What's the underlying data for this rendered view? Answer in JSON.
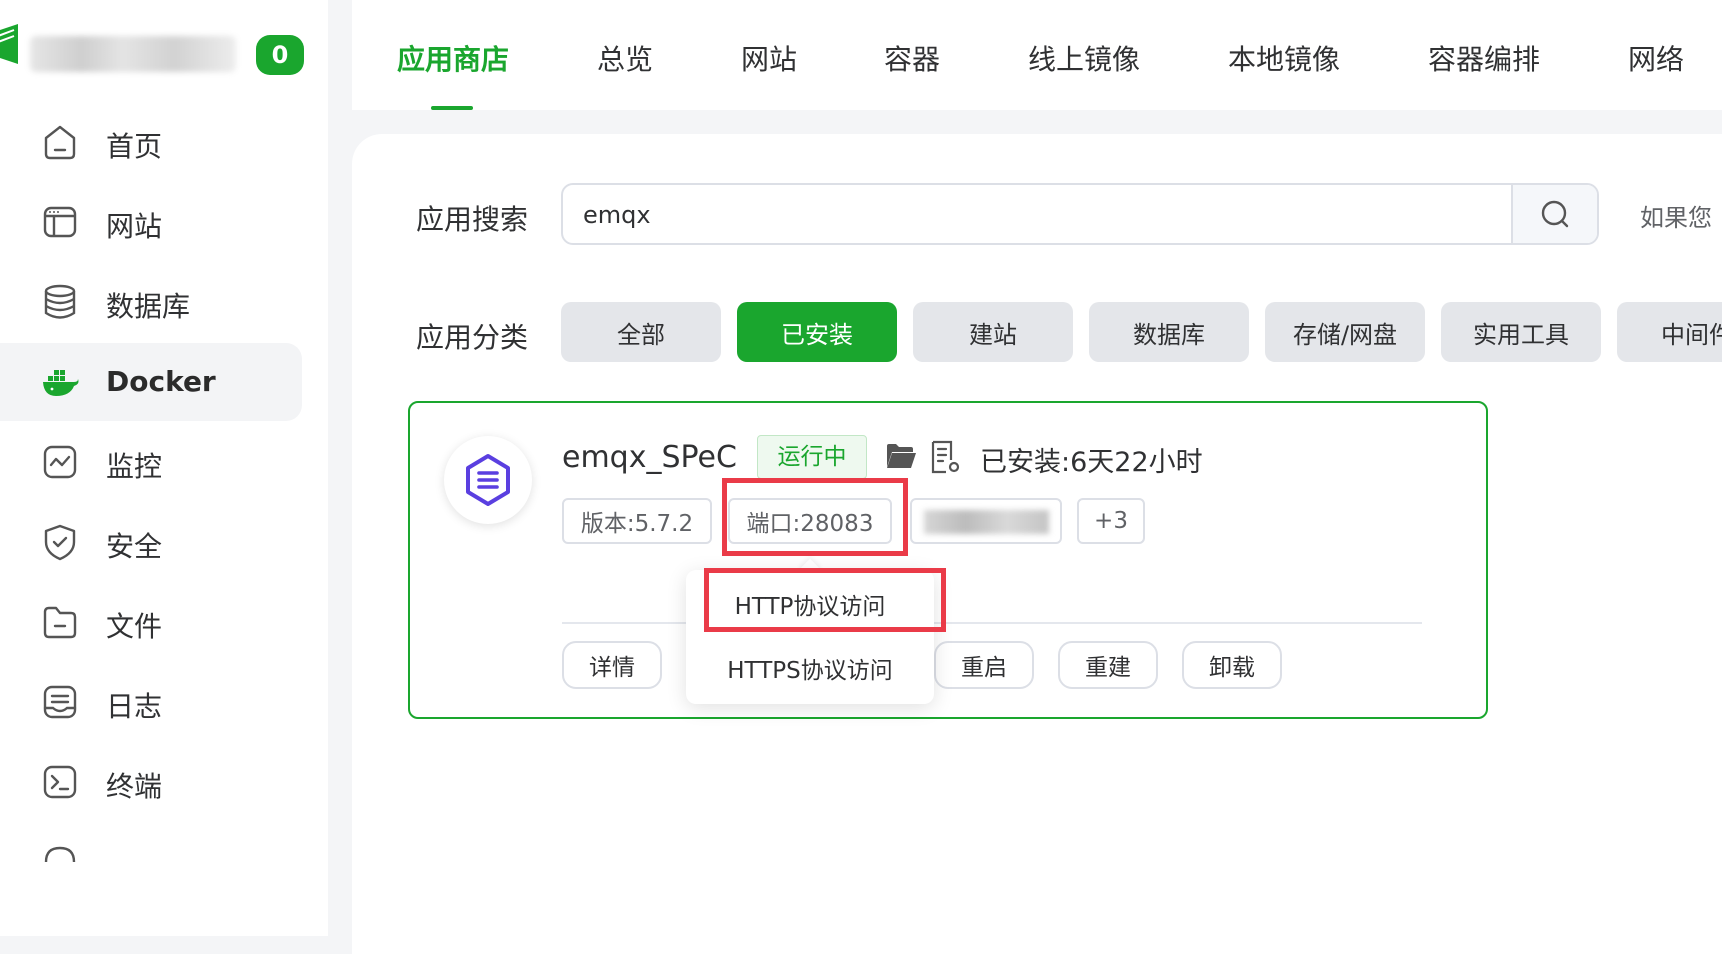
{
  "brand": {
    "badge_count": "0",
    "accent_color": "#1aa62e",
    "highlight_color": "#ea3b48"
  },
  "sidebar": {
    "items": [
      {
        "label": "首页",
        "icon": "home-icon"
      },
      {
        "label": "网站",
        "icon": "website-icon"
      },
      {
        "label": "数据库",
        "icon": "database-icon"
      },
      {
        "label": "Docker",
        "icon": "docker-icon",
        "active": true
      },
      {
        "label": "监控",
        "icon": "monitor-icon"
      },
      {
        "label": "安全",
        "icon": "shield-icon"
      },
      {
        "label": "文件",
        "icon": "folder-icon"
      },
      {
        "label": "日志",
        "icon": "log-icon"
      },
      {
        "label": "终端",
        "icon": "terminal-icon"
      }
    ]
  },
  "tabs": [
    {
      "label": "应用商店",
      "active": true
    },
    {
      "label": "总览"
    },
    {
      "label": "网站"
    },
    {
      "label": "容器"
    },
    {
      "label": "线上镜像"
    },
    {
      "label": "本地镜像"
    },
    {
      "label": "容器编排"
    },
    {
      "label": "网络"
    }
  ],
  "search": {
    "label": "应用搜索",
    "value": "emqx",
    "hint": "如果您"
  },
  "category": {
    "label": "应用分类",
    "items": [
      "全部",
      "已安装",
      "建站",
      "数据库",
      "存储/网盘",
      "实用工具",
      "中间件"
    ],
    "active": "已安装"
  },
  "app": {
    "name": "emqx_SPeC",
    "status": "运行中",
    "installed": "已安装:6天22小时",
    "version_tag": "版本:5.7.2",
    "port_tag": "端口:28083",
    "more_tag": "+3",
    "actions": [
      "详情",
      "重启",
      "重建",
      "卸载"
    ]
  },
  "port_menu": {
    "items": [
      "HTTP协议访问",
      "HTTPS协议访问"
    ]
  }
}
